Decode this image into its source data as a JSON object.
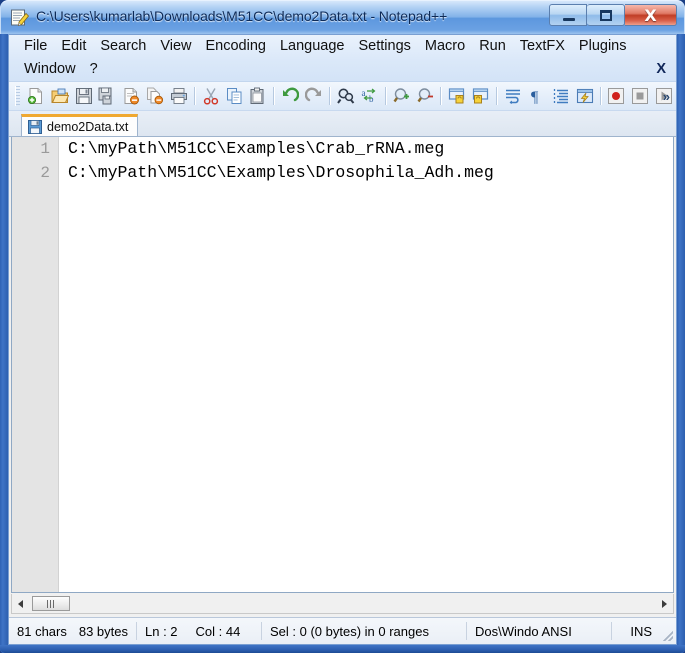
{
  "window": {
    "title": "C:\\Users\\kumarlab\\Downloads\\M51CC\\demo2Data.txt - Notepad++",
    "app_icon": "notepad-plus-plus-icon",
    "controls": {
      "minimize_label": "Minimize",
      "maximize_label": "Maximize",
      "close_label": "X"
    },
    "accent_title_color": "#7fb0e8",
    "close_button_color": "#c03e26"
  },
  "menubar": {
    "row1": [
      {
        "label": "File",
        "name": "menu-file"
      },
      {
        "label": "Edit",
        "name": "menu-edit"
      },
      {
        "label": "Search",
        "name": "menu-search"
      },
      {
        "label": "View",
        "name": "menu-view"
      },
      {
        "label": "Encoding",
        "name": "menu-encoding"
      },
      {
        "label": "Language",
        "name": "menu-language"
      },
      {
        "label": "Settings",
        "name": "menu-settings"
      },
      {
        "label": "Macro",
        "name": "menu-macro"
      },
      {
        "label": "Run",
        "name": "menu-run"
      },
      {
        "label": "TextFX",
        "name": "menu-textfx"
      },
      {
        "label": "Plugins",
        "name": "menu-plugins"
      }
    ],
    "row2": [
      {
        "label": "Window",
        "name": "menu-window"
      },
      {
        "label": "?",
        "name": "menu-help"
      }
    ],
    "close_document_label": "X"
  },
  "toolbar": {
    "overflow_label": "»",
    "buttons": [
      {
        "name": "new-file-icon",
        "title": "New"
      },
      {
        "name": "open-file-icon",
        "title": "Open"
      },
      {
        "name": "save-icon",
        "title": "Save"
      },
      {
        "name": "save-all-icon",
        "title": "Save All"
      },
      {
        "name": "close-file-icon",
        "title": "Close"
      },
      {
        "name": "close-all-files-icon",
        "title": "Close All"
      },
      {
        "name": "print-icon",
        "title": "Print"
      },
      {
        "name": "cut-icon",
        "title": "Cut"
      },
      {
        "name": "copy-icon",
        "title": "Copy"
      },
      {
        "name": "paste-icon",
        "title": "Paste"
      },
      {
        "name": "undo-icon",
        "title": "Undo"
      },
      {
        "name": "redo-icon",
        "title": "Redo"
      },
      {
        "name": "find-icon",
        "title": "Find"
      },
      {
        "name": "replace-icon",
        "title": "Replace"
      },
      {
        "name": "zoom-in-icon",
        "title": "Zoom In"
      },
      {
        "name": "zoom-out-icon",
        "title": "Zoom Out"
      },
      {
        "name": "sync-vertical-icon",
        "title": "Synchronize Vertical Scrolling"
      },
      {
        "name": "sync-horizontal-icon",
        "title": "Synchronize Horizontal Scrolling"
      },
      {
        "name": "word-wrap-icon",
        "title": "Word wrap"
      },
      {
        "name": "show-all-chars-icon",
        "title": "Show All Characters"
      },
      {
        "name": "indent-guide-icon",
        "title": "Show Indent Guide"
      },
      {
        "name": "user-define-dialog-icon",
        "title": "User Defined Dialogue"
      },
      {
        "name": "macro-record-icon",
        "title": "Start Recording"
      },
      {
        "name": "macro-stop-icon",
        "title": "Stop Recording"
      },
      {
        "name": "macro-play-icon",
        "title": "Playback"
      }
    ]
  },
  "tabs": [
    {
      "label": "demo2Data.txt",
      "icon": "saved-file-icon",
      "active": true
    }
  ],
  "editor": {
    "line_numbers": [
      "1",
      "2"
    ],
    "lines": [
      "C:\\myPath\\M51CC\\Examples\\Crab_rRNA.meg",
      "C:\\myPath\\M51CC\\Examples\\Drosophila_Adh.meg"
    ]
  },
  "hscrollbar": {
    "left_arrow": "scroll-left-icon",
    "right_arrow": "scroll-right-icon"
  },
  "statusbar": {
    "chars": "81 chars",
    "bytes": "83 bytes",
    "line": "Ln : 2",
    "column": "Col : 44",
    "selection": "Sel : 0 (0 bytes) in 0 ranges",
    "eol_encoding": "Dos\\Windo ANSI",
    "insert_mode": "INS"
  }
}
